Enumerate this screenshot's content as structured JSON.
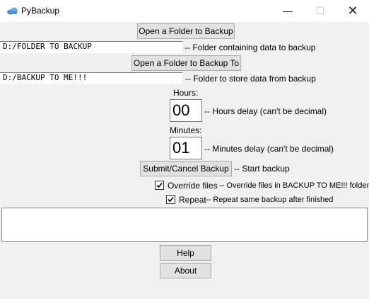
{
  "window": {
    "title": "PyBackup",
    "minimize_glyph": "—",
    "maximize_glyph": "☐",
    "close_glyph": "✕",
    "icon": "cloud-icon"
  },
  "source": {
    "button_label": "Open a Folder to Backup",
    "path": "D:/FOLDER TO BACKUP",
    "description": "-- Folder containing data to backup"
  },
  "destination": {
    "button_label": "Open a Folder to Backup To",
    "path": "D:/BACKUP TO ME!!!",
    "description": "-- Folder to store data from backup"
  },
  "hours": {
    "label": "Hours:",
    "value": "00",
    "description": "-- Hours delay (can't be decimal)"
  },
  "minutes": {
    "label": "Minutes:",
    "value": "01",
    "description": "-- Minutes delay (can't be decimal)"
  },
  "submit": {
    "button_label": "Submit/Cancel Backup",
    "description": "-- Start backup"
  },
  "override": {
    "label": "Override files",
    "description": "-- Override files in BACKUP TO ME!!! folder",
    "checked": true
  },
  "repeat": {
    "label": "Repeat",
    "description": "-- Repeat same backup after finished",
    "checked": true
  },
  "log": {
    "text": ""
  },
  "footer": {
    "help_label": "Help",
    "about_label": "About"
  },
  "colors": {
    "background": "#f0f0f0",
    "button_face": "#e1e1e1",
    "icon_accent": "#4a90d9"
  }
}
